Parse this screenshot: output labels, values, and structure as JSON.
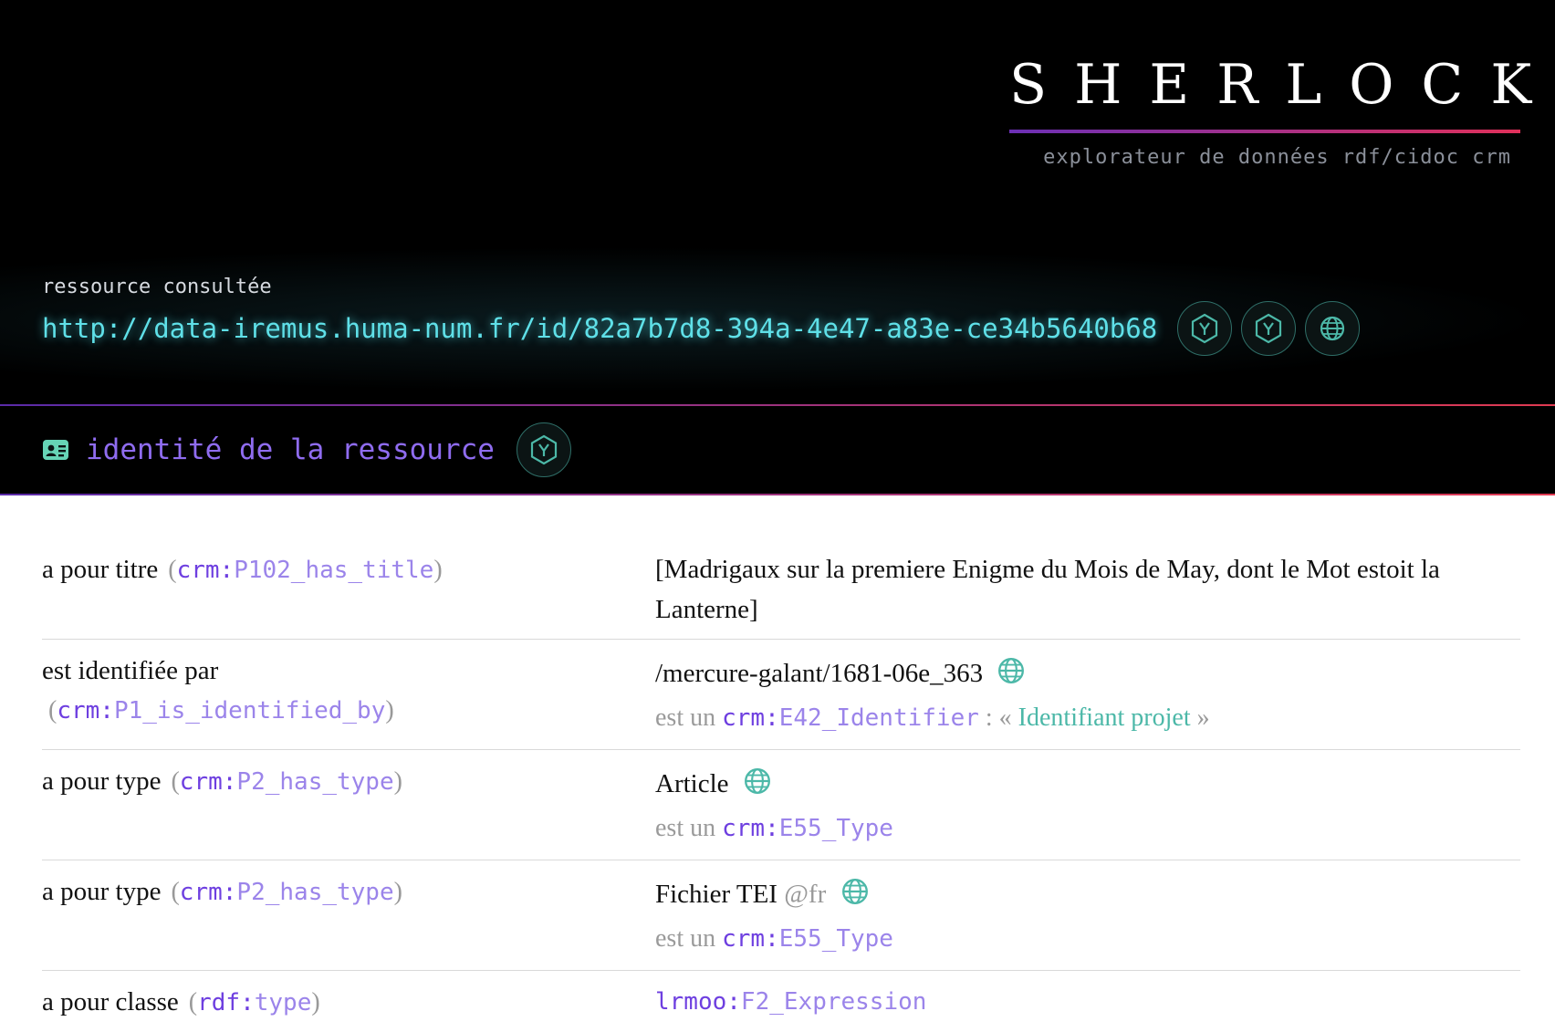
{
  "brand": {
    "title": "SHERLOCK",
    "subtitle": "explorateur de données rdf/cidoc crm"
  },
  "resource": {
    "label": "ressource consultée",
    "uri": "http://data-iremus.huma-num.fr/id/82a7b7d8-394a-4e47-a83e-ce34b5640b68",
    "action_icons": [
      "yasgui-icon",
      "yasgui-icon",
      "globe-icon"
    ]
  },
  "section": {
    "icon": "id-card-icon",
    "title": "identité de la ressource",
    "action_icon": "yasgui-icon"
  },
  "properties": [
    {
      "label": "a pour titre",
      "prefix": "crm:",
      "local": "P102_has_title",
      "value": "[Madrigaux sur la premiere Enigme du Mois de May, dont le Mot estoit la Lanterne]"
    },
    {
      "label": "est identifiée par",
      "prefix": "crm:",
      "local": "P1_is_identified_by",
      "value": "/mercure-galant/1681-06e_363",
      "type_prefix_text": "est un",
      "type_prefix": "crm:",
      "type_local": "E42_Identifier",
      "type_sep": " : «",
      "type_label": "Identifiant projet",
      "type_close": "»"
    },
    {
      "label": "a pour type",
      "prefix": "crm:",
      "local": "P2_has_type",
      "value": "Article",
      "type_prefix_text": "est un",
      "type_prefix": "crm:",
      "type_local": "E55_Type"
    },
    {
      "label": "a pour type",
      "prefix": "crm:",
      "local": "P2_has_type",
      "value": "Fichier TEI",
      "lang": "@fr",
      "type_prefix_text": "est un",
      "type_prefix": "crm:",
      "type_local": "E55_Type"
    },
    {
      "label": "a pour classe",
      "prefix": "rdf:",
      "local": "type",
      "value_prefix": "lrmoo:",
      "value_local": "F2_Expression"
    }
  ],
  "colors": {
    "accent_purple": "#8f6cf0",
    "accent_teal": "#4cb8a8",
    "uri_cyan": "#5fe0e8",
    "gradient_start": "#5a2ba8",
    "gradient_end": "#e03a52"
  }
}
